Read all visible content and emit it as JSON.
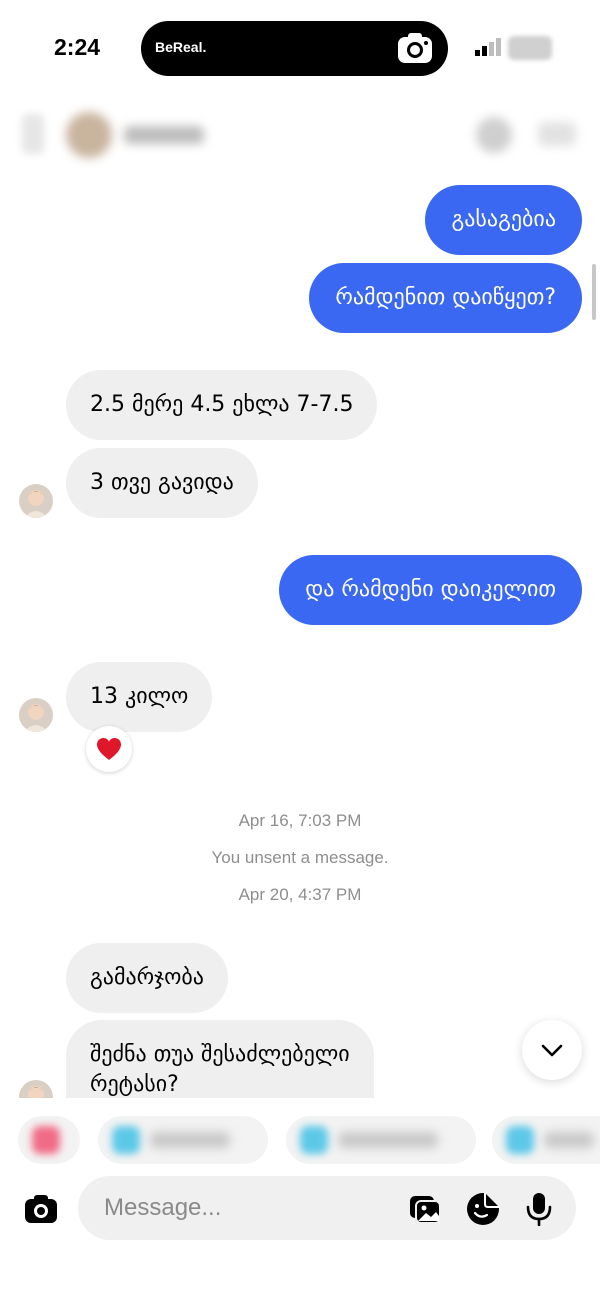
{
  "status_bar": {
    "time": "2:24",
    "island_app": "BeReal."
  },
  "header": {
    "contact_name": "Nikoloz"
  },
  "messages": [
    {
      "id": "m1",
      "direction": "sent",
      "text": "გასაგებია"
    },
    {
      "id": "m2",
      "direction": "sent",
      "text": "რამდენით დაიწყეთ?"
    },
    {
      "id": "m3",
      "direction": "received",
      "text": "2.5 მერე 4.5 ეხლა 7-7.5"
    },
    {
      "id": "m4",
      "direction": "received",
      "text": "3 თვე გავიდა"
    },
    {
      "id": "m5",
      "direction": "sent",
      "text": "და რამდენი დაიკელით"
    },
    {
      "id": "m6",
      "direction": "received",
      "text": "13 კილო",
      "reaction": "heart"
    },
    {
      "id": "m7",
      "direction": "received",
      "text": "გამარჯობა"
    },
    {
      "id": "m8",
      "direction": "received",
      "text_line1": "შეძნა თუა შესაძლებელი",
      "text_line2": "რეტასი?"
    }
  ],
  "meta": {
    "timestamp_1": "Apr 16, 7:03 PM",
    "unsent_notice": "You unsent a message.",
    "timestamp_2": "Apr 20, 4:37 PM"
  },
  "composer": {
    "placeholder": "Message..."
  },
  "colors": {
    "sent_bubble": "#3a68f2",
    "received_bubble": "#efefef",
    "meta_text": "#8e8e8e"
  },
  "icons": {
    "camera": "camera-icon",
    "gallery": "gallery-icon",
    "sticker": "sticker-icon",
    "mic": "microphone-icon",
    "scroll": "chevron-down-icon",
    "reaction": "heart-icon"
  }
}
